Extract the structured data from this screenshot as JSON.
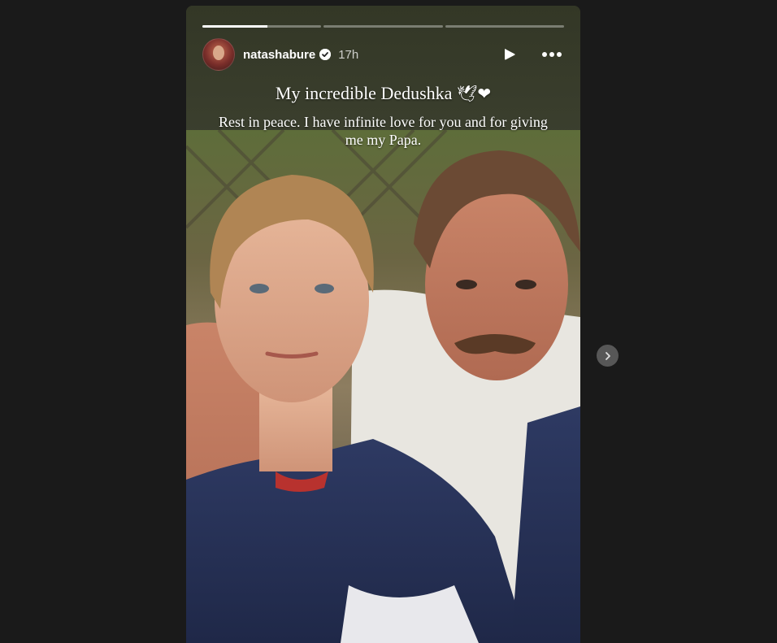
{
  "story": {
    "progress": [
      1,
      0,
      0
    ],
    "progress_current": 0.55,
    "user": {
      "username": "natashabure",
      "verified": true,
      "time": "17h"
    },
    "caption": {
      "title": "My incredible Dedushka",
      "title_emoji": "🕊❤",
      "body": "Rest in peace. I have infinite love for you and for giving me my Papa."
    },
    "controls": {
      "play_icon": "play-icon",
      "more_icon": "more-icon",
      "next_icon": "chevron-right-icon"
    }
  },
  "colors": {
    "background": "#1a1a1a",
    "story_top": "#373b2a",
    "progress_active": "#ffffff",
    "next_button": "#575757"
  }
}
